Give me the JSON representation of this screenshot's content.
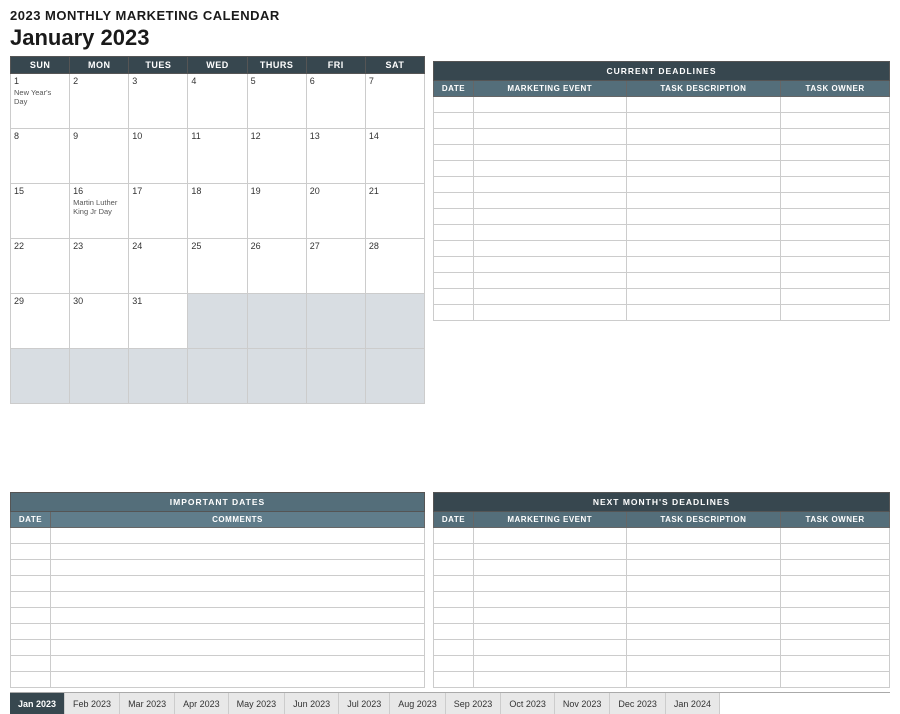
{
  "app": {
    "title": "2023 MONTHLY MARKETING CALENDAR"
  },
  "calendar": {
    "month_title": "January 2023",
    "days_header": [
      "SUN",
      "MON",
      "TUES",
      "WED",
      "THURS",
      "FRI",
      "SAT"
    ],
    "weeks": [
      [
        {
          "day": "1",
          "holiday": "New Year's Day"
        },
        {
          "day": "2"
        },
        {
          "day": "3"
        },
        {
          "day": "4"
        },
        {
          "day": "5"
        },
        {
          "day": "6"
        },
        {
          "day": "7"
        }
      ],
      [
        {
          "day": "8"
        },
        {
          "day": "9"
        },
        {
          "day": "10"
        },
        {
          "day": "11"
        },
        {
          "day": "12"
        },
        {
          "day": "13"
        },
        {
          "day": "14"
        }
      ],
      [
        {
          "day": "15"
        },
        {
          "day": "16",
          "holiday": "Martin Luther King Jr Day"
        },
        {
          "day": "17"
        },
        {
          "day": "18"
        },
        {
          "day": "19"
        },
        {
          "day": "20"
        },
        {
          "day": "21"
        }
      ],
      [
        {
          "day": "22"
        },
        {
          "day": "23"
        },
        {
          "day": "24"
        },
        {
          "day": "25"
        },
        {
          "day": "26"
        },
        {
          "day": "27"
        },
        {
          "day": "28"
        }
      ],
      [
        {
          "day": "29"
        },
        {
          "day": "30"
        },
        {
          "day": "31"
        },
        {
          "day": "",
          "empty": true
        },
        {
          "day": "",
          "empty": true
        },
        {
          "day": "",
          "empty": true
        },
        {
          "day": "",
          "empty": true
        }
      ],
      [
        {
          "day": "",
          "empty": true
        },
        {
          "day": "",
          "empty": true
        },
        {
          "day": "",
          "empty": true
        },
        {
          "day": "",
          "empty": true
        },
        {
          "day": "",
          "empty": true
        },
        {
          "day": "",
          "empty": true
        },
        {
          "day": "",
          "empty": true
        }
      ]
    ]
  },
  "current_deadlines": {
    "title": "CURRENT DEADLINES",
    "columns": [
      "DATE",
      "MARKETING EVENT",
      "TASK DESCRIPTION",
      "TASK OWNER"
    ],
    "rows": 14
  },
  "important_dates": {
    "title": "IMPORTANT DATES",
    "columns": [
      "DATE",
      "COMMENTS"
    ],
    "rows": 10
  },
  "next_month_deadlines": {
    "title": "NEXT MONTH'S DEADLINES",
    "columns": [
      "DATE",
      "MARKETING EVENT",
      "TASK DESCRIPTION",
      "TASK OWNER"
    ],
    "rows": 10
  },
  "tabs": [
    {
      "label": "Jan 2023",
      "active": true
    },
    {
      "label": "Feb 2023"
    },
    {
      "label": "Mar 2023"
    },
    {
      "label": "Apr 2023"
    },
    {
      "label": "May 2023"
    },
    {
      "label": "Jun 2023"
    },
    {
      "label": "Jul 2023"
    },
    {
      "label": "Aug 2023"
    },
    {
      "label": "Sep 2023"
    },
    {
      "label": "Oct 2023"
    },
    {
      "label": "Nov 2023"
    },
    {
      "label": "Dec 2023"
    },
    {
      "label": "Jan 2024"
    }
  ]
}
